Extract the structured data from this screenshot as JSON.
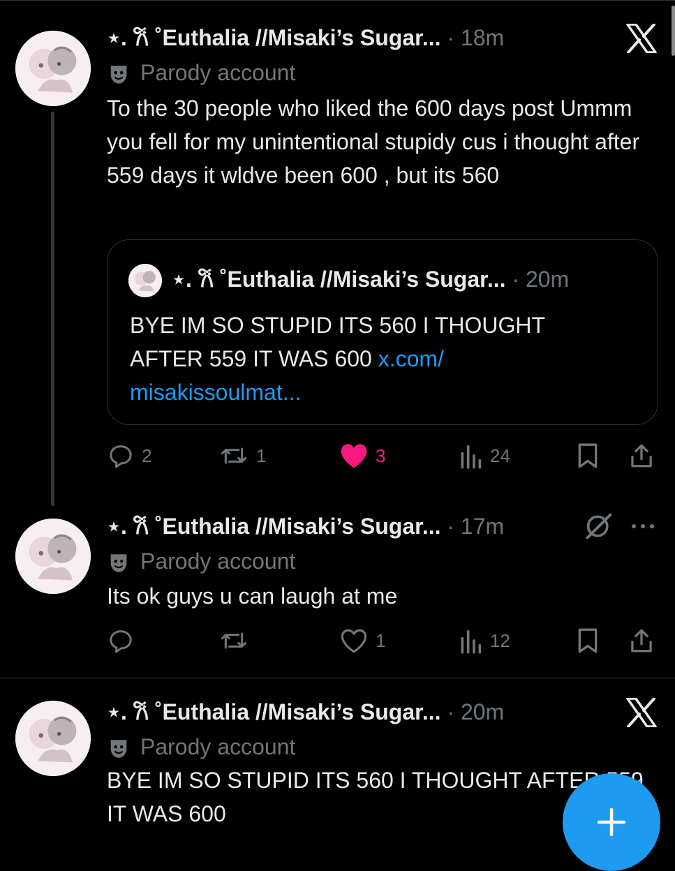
{
  "colors": {
    "accent": "#1d9bf0",
    "like": "#f91880",
    "muted": "#71767b",
    "text": "#e7e9ea",
    "background": "#000000"
  },
  "tweets": [
    {
      "name": "⋆. 𐙚 ˚Euthalia //Misaki’s Sugar...",
      "time": "· 18m",
      "badge": "Parody account",
      "text": "To the 30 people who liked the 600 days post Ummm you fell for my unintentional stupidy cus i thought after 559 days it wldve been 600 , but its 560",
      "corner_icon": "x-logo-icon",
      "quote": {
        "name": "⋆. 𐙚 ˚Euthalia //Misaki’s Sugar...",
        "time": "· 20m",
        "text": "BYE IM SO STUPID ITS 560 I THOUGHT AFTER 559 IT WAS 600 ",
        "link": "x.com/ misakissoulmat..."
      },
      "actions": {
        "replies": "2",
        "reposts": "1",
        "likes": "3",
        "views": "24"
      },
      "liked": true
    },
    {
      "name": "⋆. 𐙚 ˚Euthalia //Misaki’s Sugar...",
      "time": "· 17m",
      "badge": "Parody account",
      "text": "Its ok guys u can laugh at me",
      "corner_icon": "grok-icon",
      "actions": {
        "replies": "",
        "reposts": "",
        "likes": "1",
        "views": "12"
      },
      "liked": false
    },
    {
      "name": "⋆. 𐙚 ˚Euthalia //Misaki’s Sugar...",
      "time": "· 20m",
      "badge": "Parody account",
      "text": "BYE IM SO STUPID ITS 560 I THOUGHT AFTER 559 IT WAS 600",
      "corner_icon": "x-logo-icon"
    }
  ],
  "fab": {
    "icon": "plus-icon",
    "label": "Compose post"
  }
}
